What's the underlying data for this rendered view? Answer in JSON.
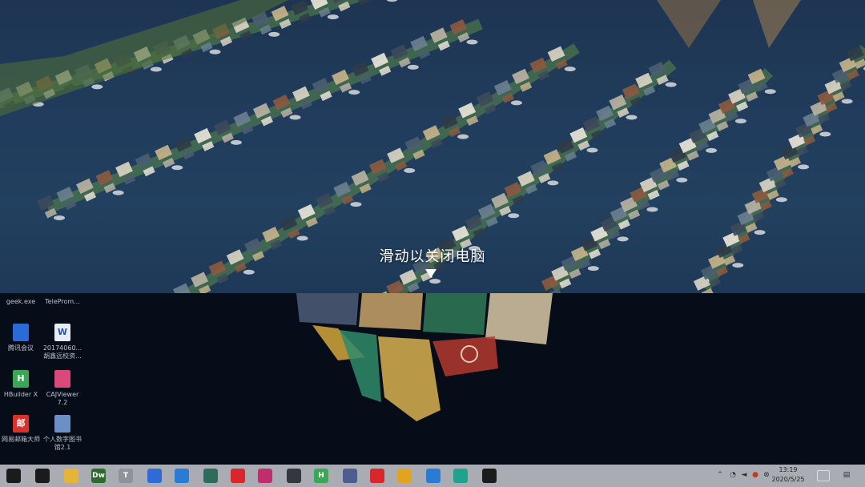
{
  "lock_overlay": {
    "message": "滑动以关闭电脑"
  },
  "desktop": {
    "icons": [
      {
        "label": "geek.exe",
        "icon": "geek-app-icon",
        "color": "#6a7b8d",
        "glyph": ""
      },
      {
        "label": "TeleProm...",
        "icon": "teleprompter-app-icon",
        "color": "#5a6b7d",
        "glyph": ""
      },
      {
        "label": "腾讯会议",
        "icon": "tencent-meeting-icon",
        "color": "#2a6bd8",
        "glyph": ""
      },
      {
        "label": "20174060...胡鑫远校资...",
        "icon": "word-document-icon",
        "color": "#e8edf5",
        "glyph": "W"
      },
      {
        "label": "HBuilder X",
        "icon": "hbuilder-icon",
        "color": "#3aa757",
        "glyph": "H"
      },
      {
        "label": "CAJViewer 7.2",
        "icon": "cajviewer-icon",
        "color": "#d94a7a",
        "glyph": ""
      },
      {
        "label": "网易邮箱大师",
        "icon": "netease-mail-icon",
        "color": "#d9322c",
        "glyph": "邮"
      },
      {
        "label": "个人数字图书馆2.1",
        "icon": "digital-library-icon",
        "color": "#6c8fc8",
        "glyph": ""
      }
    ]
  },
  "taskbar": {
    "apps": [
      {
        "icon": "start-windows-icon",
        "color": "#1b1b1b",
        "glyph": ""
      },
      {
        "icon": "task-view-icon",
        "color": "#1b1b1b",
        "glyph": ""
      },
      {
        "icon": "file-explorer-icon",
        "color": "#e7b43a",
        "glyph": ""
      },
      {
        "icon": "dreamweaver-icon",
        "color": "#2d6a2d",
        "glyph": "Dw"
      },
      {
        "icon": "typora-icon",
        "color": "#8f9399",
        "glyph": "T"
      },
      {
        "icon": "feishu-icon",
        "color": "#2f6ad6",
        "glyph": ""
      },
      {
        "icon": "vscode-icon",
        "color": "#2a7bd4",
        "glyph": ""
      },
      {
        "icon": "terminal-app-icon",
        "color": "#2d6b5a",
        "glyph": ""
      },
      {
        "icon": "netease-music-icon",
        "color": "#d8262c",
        "glyph": ""
      },
      {
        "icon": "jetbrains-icon",
        "color": "#c02e6e",
        "glyph": ""
      },
      {
        "icon": "media-player-icon",
        "color": "#33383f",
        "glyph": ""
      },
      {
        "icon": "hbuilder-taskbar-icon",
        "color": "#3aa757",
        "glyph": "H"
      },
      {
        "icon": "virtualbox-icon",
        "color": "#4c5d8e",
        "glyph": ""
      },
      {
        "icon": "xmind-icon",
        "color": "#d8262c",
        "glyph": ""
      },
      {
        "icon": "chrome-icon",
        "color": "#e0a423",
        "glyph": ""
      },
      {
        "icon": "edge-icon",
        "color": "#2a7bd4",
        "glyph": ""
      },
      {
        "icon": "edge-beta-icon",
        "color": "#1fa38c",
        "glyph": ""
      },
      {
        "icon": "qq-penguin-icon",
        "color": "#1b1b1b",
        "glyph": ""
      }
    ],
    "clock": {
      "time": "13:19",
      "date": "2020/5/25"
    }
  }
}
